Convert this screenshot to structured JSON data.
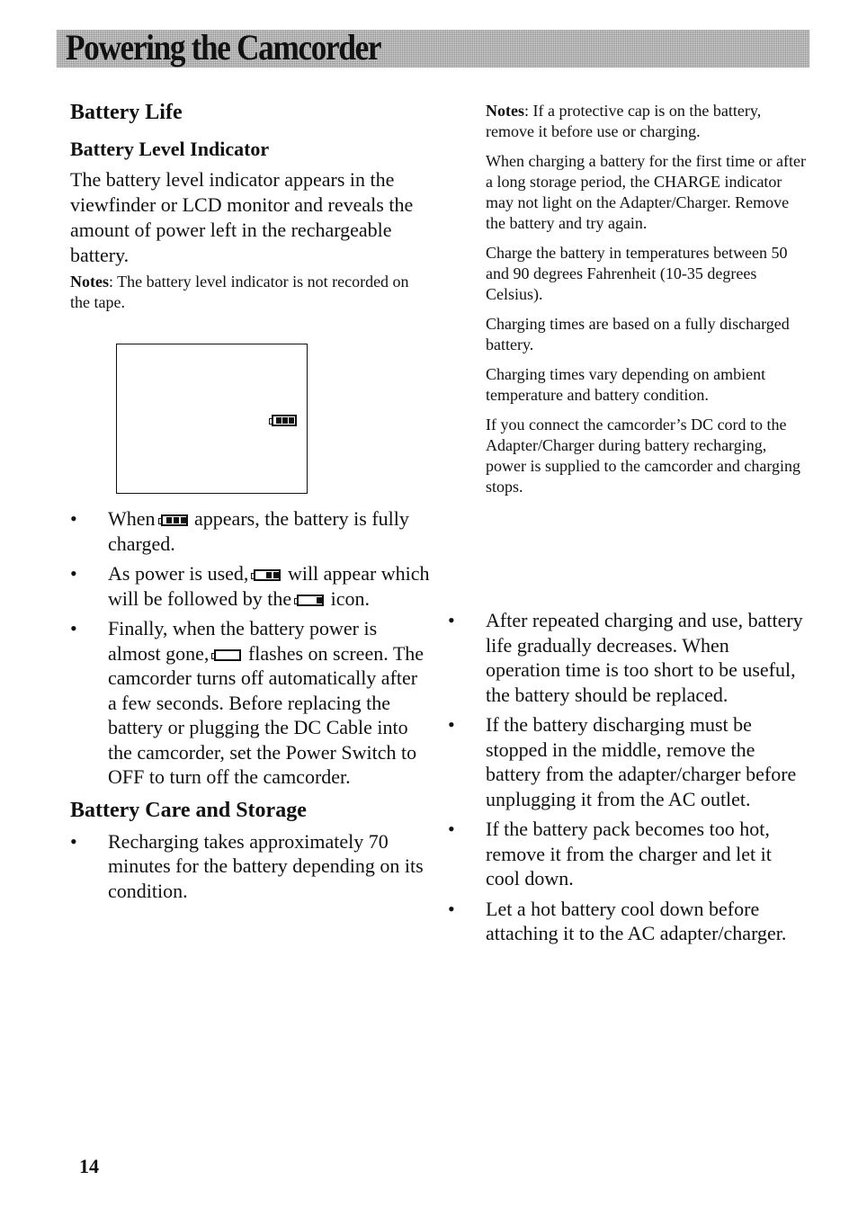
{
  "banner": {
    "title": "Powering the Camcorder"
  },
  "left": {
    "heading": "Battery Life",
    "subheading": "Battery Level Indicator",
    "intro": "The battery level indicator appears in the viewfinder or LCD monitor and reveals the amount of power left in the rechargeable battery.",
    "note": {
      "label": "Notes",
      "text": ": The battery level indicator is not recorded on the tape."
    },
    "screen_indicator": {
      "icon": "battery-full-icon",
      "level_bars": 3,
      "max_bars": 3
    },
    "bullets": [
      {
        "before": "When",
        "icon": "battery-full-icon",
        "bars": 3,
        "after": "appears, the battery is fully charged."
      },
      {
        "before": "As power is used,",
        "icon": "battery-two-thirds-icon",
        "bars": 2,
        "after": "will appear which will be followed by",
        "continuation_before": "the",
        "continuation_icon": "battery-one-third-icon",
        "continuation_bars": 1,
        "continuation_after": "icon."
      },
      {
        "before": "Finally, when the battery power is almost gone,",
        "icon": "battery-empty-icon",
        "bars": 0,
        "after": "flashes on screen. The camcorder turns off automatically after a few seconds. Before replacing the battery or plugging the DC Cable into the camcorder, set the Power Switch to  OFF to turn off the camcorder."
      }
    ],
    "care_heading": "Battery Care and Storage",
    "care_bullets": [
      "Recharging takes approximately 70 minutes for the battery depending on its condition."
    ]
  },
  "right": {
    "notes": [
      {
        "label": "Notes",
        "text": ": If a protective cap is on the battery, remove it before use or charging."
      },
      {
        "label": "",
        "text": "When charging a battery for the first time or after a long storage period, the CHARGE indicator may not light on the Adapter/Charger. Remove the battery and try again."
      },
      {
        "label": "",
        "text": "Charge the battery in temperatures between 50 and 90 degrees Fahrenheit (10-35 degrees Celsius)."
      },
      {
        "label": "",
        "text": "Charging times are based on a fully discharged battery."
      },
      {
        "label": "",
        "text": "Charging times vary depending on ambient temperature and battery condition."
      },
      {
        "label": "",
        "text": "If you connect the camcorder’s DC cord to the Adapter/Charger during battery recharging, power is supplied to the camcorder and charging stops."
      }
    ],
    "bullets": [
      "After repeated charging and use, battery life gradually decreases. When operation time is too short to be useful, the battery should be replaced.",
      "If the battery discharging must be stopped in the middle, remove the battery from the adapter/charger before unplugging it from the AC outlet.",
      "If the battery pack becomes too hot,  remove it from the charger and let it cool down.",
      "Let a hot battery cool down before attaching it to the AC adapter/charger."
    ]
  },
  "footer": {
    "page_number": "14"
  },
  "bullet_glyph": "•"
}
